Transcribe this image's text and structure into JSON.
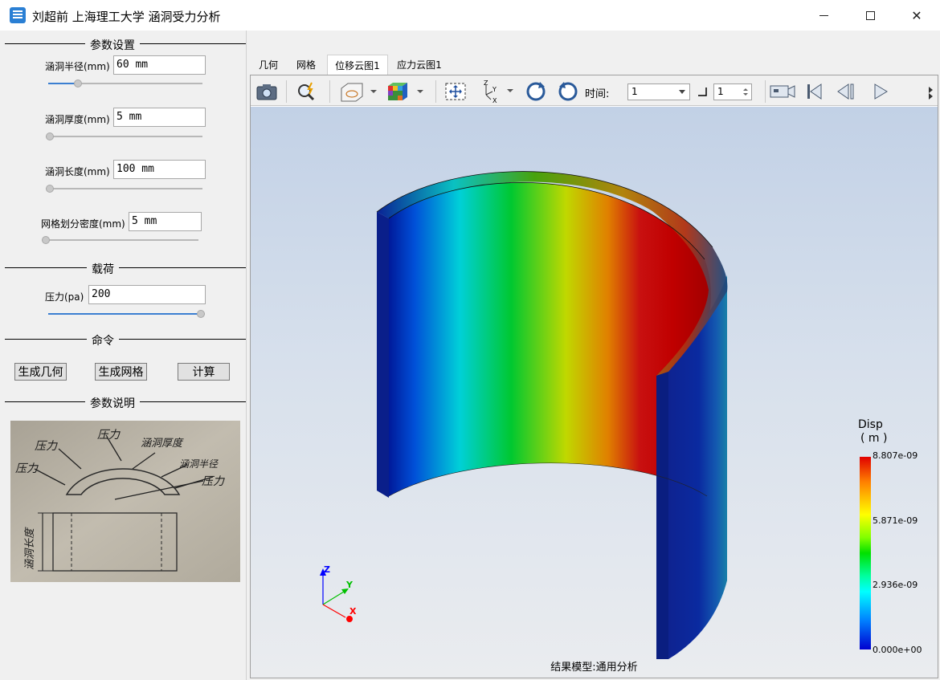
{
  "window": {
    "title": "刘超前 上海理工大学 涵洞受力分析",
    "app_icon": "app-logo-icon"
  },
  "left_panel": {
    "param_group_title": "参数设置",
    "params": [
      {
        "label": "涵洞半径(mm)",
        "value": "60 mm",
        "slider_fraction": 0.19
      },
      {
        "label": "涵洞厚度(mm)",
        "value": "5 mm",
        "slider_fraction": 0.0
      },
      {
        "label": "涵洞长度(mm)",
        "value": "100 mm",
        "slider_fraction": 0.0
      },
      {
        "label": "网格划分密度(mm)",
        "value": "5 mm",
        "slider_fraction": 0.0
      }
    ],
    "load_group_title": "载荷",
    "load": {
      "label": "压力(pa)",
      "value": "200",
      "slider_fraction": 1.0
    },
    "command_group_title": "命令",
    "commands": {
      "geometry": "生成几何",
      "mesh": "生成网格",
      "compute": "计算"
    },
    "description_group_title": "参数说明",
    "sketch_annotations": [
      "压力",
      "压力",
      "涵洞厚度",
      "压力",
      "涵洞半径",
      "压力",
      "涵洞长度"
    ]
  },
  "tabs": [
    {
      "label": "几何",
      "active": false
    },
    {
      "label": "网格",
      "active": false
    },
    {
      "label": "位移云图1",
      "active": true
    },
    {
      "label": "应力云图1",
      "active": false
    }
  ],
  "toolbar": {
    "icons": [
      "camera-icon",
      "magnifier-icon",
      "display-mode-icon",
      "color-cube-icon",
      "fit-view-icon",
      "axes-icon",
      "rotate-cw-icon",
      "rotate-ccw-icon",
      "record-icon",
      "first-frame-icon",
      "previous-frame-icon",
      "play-icon"
    ],
    "time_label": "时间:",
    "time_value": "1",
    "step_value": "1"
  },
  "viewport": {
    "legend_title": "Disp",
    "legend_unit": "( m )",
    "legend_ticks": [
      "8.807e-09",
      "5.871e-09",
      "2.936e-09",
      "0.000e+00"
    ],
    "caption": "结果模型:通用分析",
    "axis_labels": {
      "x": "X",
      "y": "Y",
      "z": "Z"
    },
    "colors": {
      "max": "#e00000",
      "mid": "#00e000",
      "min": "#0000d0"
    }
  }
}
